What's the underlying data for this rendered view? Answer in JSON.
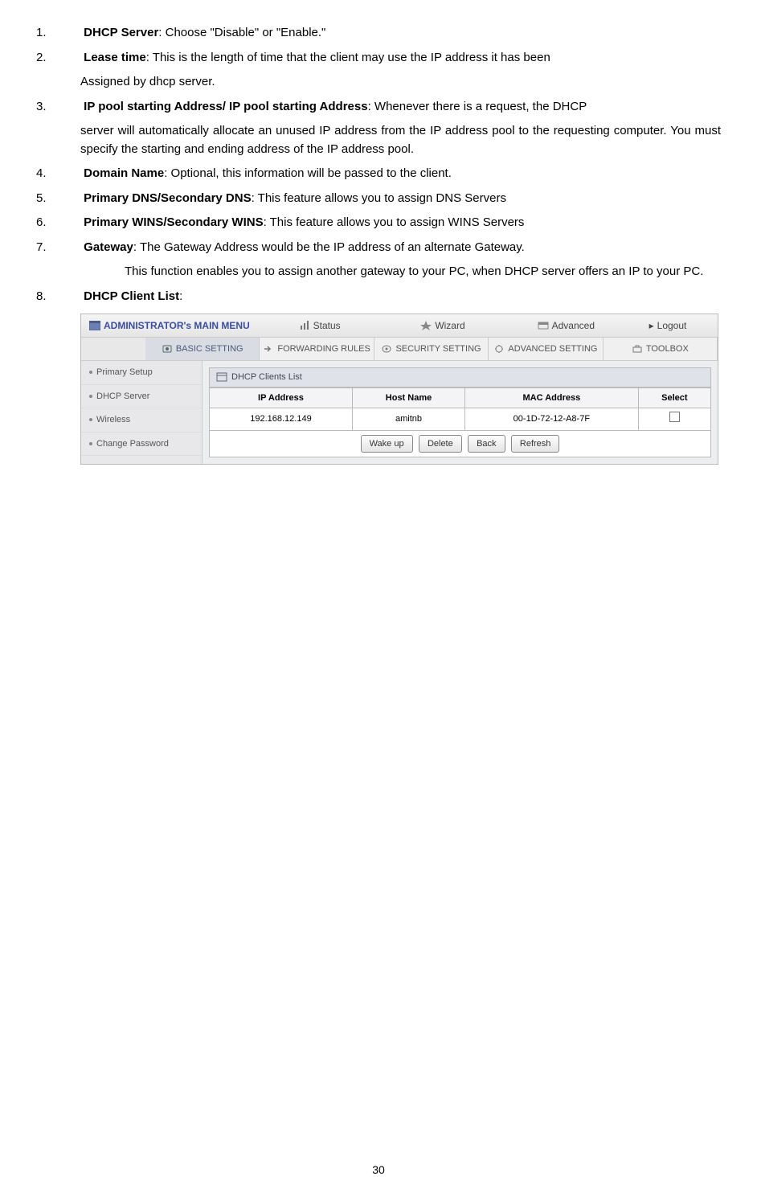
{
  "items": [
    {
      "num": "1.",
      "bold": "DHCP Server",
      "rest": ": Choose \"Disable\" or \"Enable.\""
    },
    {
      "num": "2.",
      "bold": "Lease time",
      "rest": ": This is the length of time that the client may use the IP address it has been",
      "cont1": "Assigned by dhcp server."
    },
    {
      "num": "3.",
      "bold": "IP pool starting Address/ IP pool starting Address",
      "rest": ": Whenever there is a request, the DHCP",
      "cont1": "server will automatically allocate an unused IP address from the IP address pool to the requesting computer. You must specify the starting and ending address of the IP address pool."
    },
    {
      "num": "4.",
      "bold": "Domain Name",
      "rest": ": Optional, this information will be passed to the client."
    },
    {
      "num": "5.",
      "bold": "Primary DNS/Secondary DNS",
      "rest": ": This feature allows you to assign DNS Servers"
    },
    {
      "num": "6.",
      "bold": "Primary WINS/Secondary WINS",
      "rest": ": This feature allows you to assign WINS Servers"
    },
    {
      "num": "7.",
      "bold": "Gateway",
      "rest": ": The Gateway Address would be the IP address of an alternate Gateway.",
      "sub": "This function enables you to assign another gateway to your PC, when DHCP server offers an IP to your PC."
    },
    {
      "num": "8.",
      "bold": "DHCP Client List",
      "rest": ":"
    }
  ],
  "shot": {
    "admin_title": "ADMINISTRATOR's MAIN MENU",
    "menu": {
      "status": "Status",
      "wizard": "Wizard",
      "advanced": "Advanced",
      "logout": "Logout"
    },
    "submenu": {
      "basic": "BASIC SETTING",
      "forward": "FORWARDING RULES",
      "security": "SECURITY SETTING",
      "advanced": "ADVANCED SETTING",
      "toolbox": "TOOLBOX"
    },
    "sidebar": {
      "primary": "Primary Setup",
      "dhcp": "DHCP Server",
      "wireless": "Wireless",
      "change": "Change Password"
    },
    "panel_title": "DHCP Clients List",
    "th": {
      "ip": "IP Address",
      "host": "Host Name",
      "mac": "MAC Address",
      "select": "Select"
    },
    "row": {
      "ip": "192.168.12.149",
      "host": "amitnb",
      "mac": "00-1D-72-12-A8-7F"
    },
    "btn": {
      "wake": "Wake up",
      "delete": "Delete",
      "back": "Back",
      "refresh": "Refresh"
    }
  },
  "page_number": "30"
}
